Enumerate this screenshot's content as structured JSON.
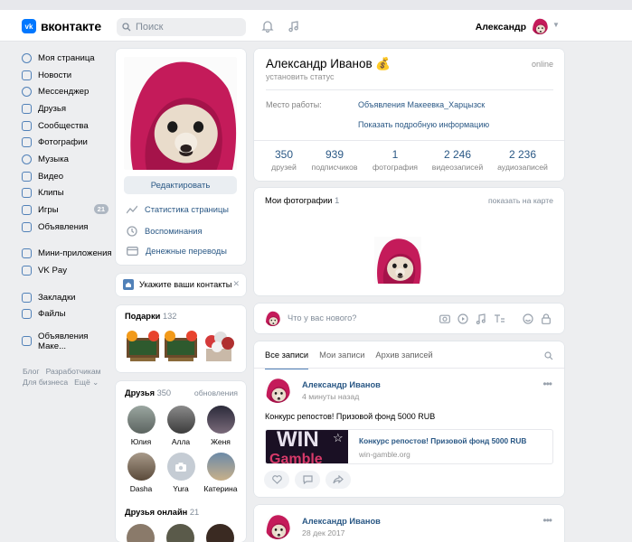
{
  "header": {
    "logo_text": "вконтакте",
    "logo_mark": "vk",
    "search_placeholder": "Поиск",
    "user_name": "Александр",
    "icons": [
      "search-icon",
      "bell-icon",
      "music-icon",
      "chevron-down-icon"
    ]
  },
  "nav": {
    "items": [
      {
        "label": "Моя страница",
        "icon": "user-icon"
      },
      {
        "label": "Новости",
        "icon": "news-icon"
      },
      {
        "label": "Мессенджер",
        "icon": "messenger-icon"
      },
      {
        "label": "Друзья",
        "icon": "friends-icon"
      },
      {
        "label": "Сообщества",
        "icon": "groups-icon"
      },
      {
        "label": "Фотографии",
        "icon": "photos-icon"
      },
      {
        "label": "Музыка",
        "icon": "music-icon"
      },
      {
        "label": "Видео",
        "icon": "video-icon"
      },
      {
        "label": "Клипы",
        "icon": "clips-icon"
      },
      {
        "label": "Игры",
        "icon": "games-icon",
        "badge": "21"
      },
      {
        "label": "Объявления",
        "icon": "ads-icon"
      }
    ],
    "items2": [
      {
        "label": "Мини-приложения",
        "icon": "apps-icon"
      },
      {
        "label": "VK Pay",
        "icon": "vkpay-icon"
      }
    ],
    "items3": [
      {
        "label": "Закладки",
        "icon": "bookmark-icon"
      },
      {
        "label": "Файлы",
        "icon": "files-icon"
      }
    ],
    "items4": [
      {
        "label": "Объявления Маке...",
        "icon": "community-icon"
      }
    ],
    "footer": [
      "Блог",
      "Разработчикам",
      "Для бизнеса",
      "Ещё ⌄"
    ]
  },
  "avatar_block": {
    "edit_label": "Редактировать",
    "links": [
      {
        "label": "Статистика страницы",
        "icon": "stats-icon"
      },
      {
        "label": "Воспоминания",
        "icon": "history-icon"
      },
      {
        "label": "Денежные переводы",
        "icon": "money-icon"
      }
    ]
  },
  "contacts": {
    "label": "Укажите ваши контакты",
    "close": "✕"
  },
  "gifts": {
    "title": "Подарки",
    "count": "132"
  },
  "friends": {
    "title": "Друзья",
    "count": "350",
    "updates_label": "обновления",
    "list": [
      "Юлия",
      "Алла",
      "Женя",
      "Dasha",
      "Yura",
      "Катерина"
    ],
    "online_title": "Друзья онлайн",
    "online_count": "21"
  },
  "profile": {
    "name": "Александр Иванов 💰",
    "online": "online",
    "status": "установить статус",
    "work_label": "Место работы:",
    "work_value": "Объявления Макеевка_Харцызск",
    "more_info": "Показать подробную информацию",
    "counters": [
      {
        "value": "350",
        "label": "друзей"
      },
      {
        "value": "939",
        "label": "подписчиков"
      },
      {
        "value": "1",
        "label": "фотография"
      },
      {
        "value": "2 246",
        "label": "видеозаписей"
      },
      {
        "value": "2 236",
        "label": "аудиозаписей"
      }
    ]
  },
  "photos": {
    "title": "Мои фотографии",
    "count": "1",
    "map_link": "показать на карте"
  },
  "compose": {
    "placeholder": "Что у вас нового?"
  },
  "wall": {
    "tabs": [
      "Все записи",
      "Мои записи",
      "Архив записей"
    ],
    "post1": {
      "author": "Александр Иванов",
      "time": "4 минуты назад",
      "text": "Конкурс репостов! Призовой фонд 5000 RUB",
      "link_title": "Конкурс репостов! Призовой фонд 5000 RUB",
      "link_domain": "win-gamble.org",
      "link_image_text": "WIN",
      "link_image_text2": "Gamble"
    },
    "post2": {
      "author": "Александр Иванов",
      "time": "28 дек 2017"
    }
  },
  "colors": {
    "accent": "#5181b8",
    "link": "#2a5885",
    "bg": "#edeef0",
    "hood": "#c41b5a"
  }
}
